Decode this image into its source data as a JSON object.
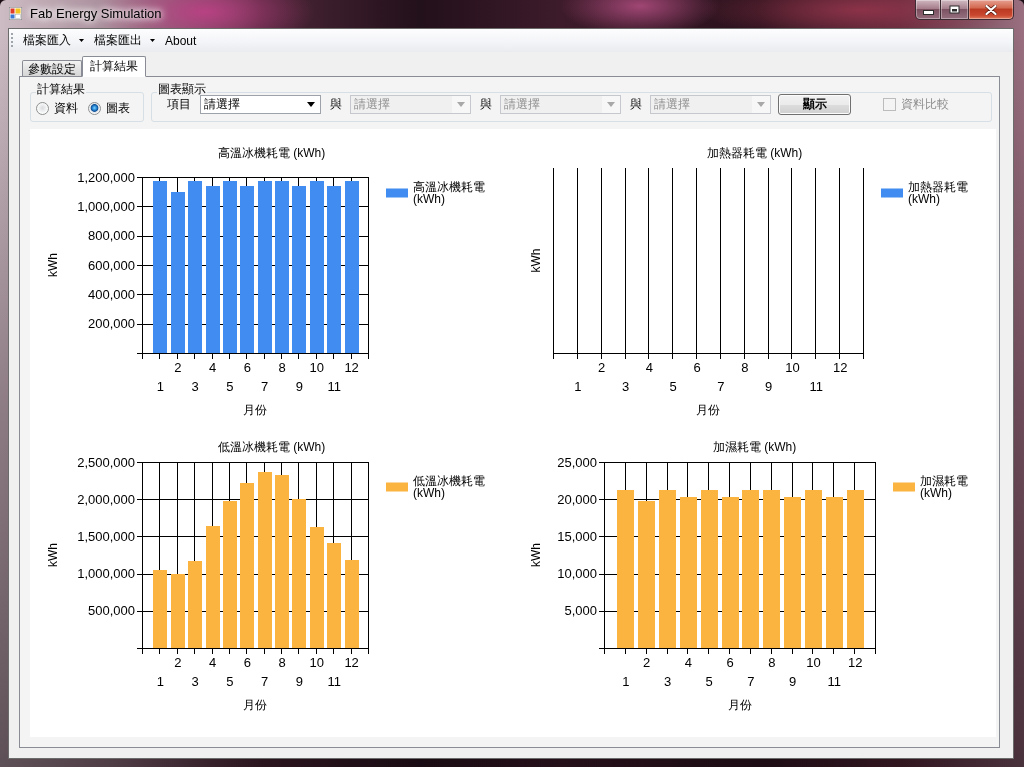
{
  "window": {
    "title": "Fab Energy Simulation"
  },
  "menu": [
    {
      "label": "檔案匯入",
      "dropdown": true
    },
    {
      "label": "檔案匯出",
      "dropdown": true
    },
    {
      "label": "About",
      "dropdown": false
    }
  ],
  "tabs": [
    {
      "label": "參數設定",
      "selected": false
    },
    {
      "label": "計算結果",
      "selected": true
    }
  ],
  "result_group": {
    "title": "計算結果",
    "options": [
      {
        "label": "資料",
        "selected": false
      },
      {
        "label": "圖表",
        "selected": true
      }
    ]
  },
  "chart_group": {
    "title": "圖表顯示",
    "item_label": "項目",
    "selectors": [
      {
        "value": "請選擇",
        "disabled": false
      },
      {
        "joiner": "與",
        "value": "請選擇",
        "disabled": true
      },
      {
        "joiner": "與",
        "value": "請選擇",
        "disabled": true
      },
      {
        "joiner": "與",
        "value": "請選擇",
        "disabled": true
      }
    ],
    "show_button": "顯示",
    "compare": {
      "label": "資料比較",
      "checked": false,
      "disabled": true
    }
  },
  "charts": [
    {
      "kind": "chart",
      "chart_data": {
        "type": "bar",
        "title": "高溫冰機耗電 (kWh)",
        "xlabel": "月份",
        "ylabel": "kWh",
        "categories": [
          "1",
          "2",
          "3",
          "4",
          "5",
          "6",
          "7",
          "8",
          "9",
          "10",
          "11",
          "12"
        ],
        "series": [
          {
            "name": "高溫冰機耗電 (kWh)",
            "color": "#418cf0",
            "values": [
              1170000,
              1100000,
              1170000,
              1140000,
              1170000,
              1140000,
              1170000,
              1170000,
              1140000,
              1170000,
              1140000,
              1170000
            ]
          }
        ],
        "ylim": [
          0,
          1200000
        ],
        "yticks": [
          {
            "value": 200000,
            "label": "200,000"
          },
          {
            "value": 400000,
            "label": "400,000"
          },
          {
            "value": 600000,
            "label": "600,000"
          },
          {
            "value": 800000,
            "label": "800,000"
          },
          {
            "value": 1000000,
            "label": "1,000,000"
          },
          {
            "value": 1200000,
            "label": "1,200,000"
          }
        ],
        "grid": true
      }
    },
    {
      "kind": "empty",
      "title": "加熱器耗電 (kWh)",
      "xlabel": "月份",
      "ylabel": "kWh",
      "categories": [
        "1",
        "2",
        "3",
        "4",
        "5",
        "6",
        "7",
        "8",
        "9",
        "10",
        "11",
        "12"
      ],
      "grid": true,
      "legend": [
        {
          "name": "加熱器耗電 (kWh)",
          "color": "#418cf0"
        }
      ]
    },
    {
      "kind": "chart",
      "chart_data": {
        "type": "bar",
        "title": "低溫冰機耗電 (kWh)",
        "xlabel": "月份",
        "ylabel": "kWh",
        "categories": [
          "1",
          "2",
          "3",
          "4",
          "5",
          "6",
          "7",
          "8",
          "9",
          "10",
          "11",
          "12"
        ],
        "series": [
          {
            "name": "低溫冰機耗電 (kWh)",
            "color": "#fcb441",
            "values": [
              1050000,
              1000000,
              1170000,
              1640000,
              1980000,
              2220000,
              2370000,
              2330000,
              2000000,
              1630000,
              1410000,
              1180000
            ]
          }
        ],
        "ylim": [
          0,
          2500000
        ],
        "yticks": [
          {
            "value": 500000,
            "label": "500,000"
          },
          {
            "value": 1000000,
            "label": "1,000,000"
          },
          {
            "value": 1500000,
            "label": "1,500,000"
          },
          {
            "value": 2000000,
            "label": "2,000,000"
          },
          {
            "value": 2500000,
            "label": "2,500,000"
          }
        ],
        "grid": true
      }
    },
    {
      "kind": "chart",
      "chart_data": {
        "type": "bar",
        "title": "加濕耗電 (kWh)",
        "xlabel": "月份",
        "ylabel": "kWh",
        "categories": [
          "1",
          "2",
          "3",
          "4",
          "5",
          "6",
          "7",
          "8",
          "9",
          "10",
          "11",
          "12"
        ],
        "series": [
          {
            "name": "加濕耗電 (kWh)",
            "color": "#fcb441",
            "values": [
              21200,
              19700,
              21200,
              20300,
              21200,
              20300,
              21200,
              21200,
              20300,
              21200,
              20300,
              21200
            ]
          }
        ],
        "ylim": [
          0,
          25000
        ],
        "yticks": [
          {
            "value": 5000,
            "label": "5,000"
          },
          {
            "value": 10000,
            "label": "10,000"
          },
          {
            "value": 15000,
            "label": "15,000"
          },
          {
            "value": 20000,
            "label": "20,000"
          },
          {
            "value": 25000,
            "label": "25,000"
          }
        ],
        "grid": true
      }
    }
  ]
}
